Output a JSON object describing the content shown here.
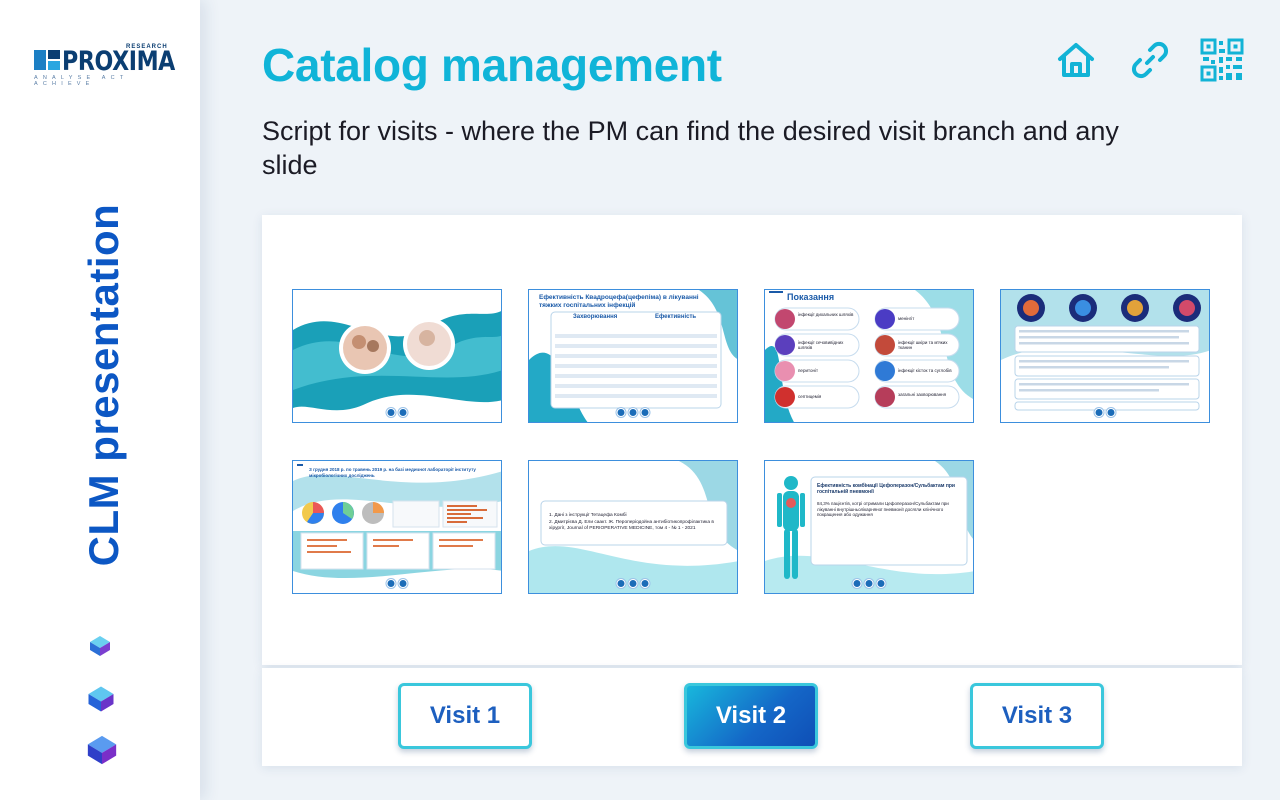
{
  "brand": {
    "name": "PROXIMA",
    "research": "RESEARCH",
    "tagline": "ANALYSE ACT ACHIEVE",
    "colors": {
      "primary": "#0c57c4",
      "accent": "#10b4d8",
      "dark": "#0b3e72"
    }
  },
  "sidebar": {
    "vertical_title": "CLM presentation"
  },
  "header": {
    "title": "Catalog management",
    "subtitle": "Script for visits - where the PM can find the desired visit branch and any slide",
    "icons": [
      "home-icon",
      "link-icon",
      "qr-code-icon"
    ]
  },
  "slides": [
    {
      "id": "slide-1",
      "heading": ""
    },
    {
      "id": "slide-2",
      "heading": "Ефективність Квадроцефа(цефепіма) в лікуванні тяжких госпітальних інфекцій",
      "col1": "Захворювання",
      "col2": "Ефективність"
    },
    {
      "id": "slide-3",
      "heading": "Показання",
      "items": [
        "інфекції дихальних шляхів",
        "менінгіт",
        "інфекції сечовивідних шляхів",
        "інфекції шкіри та м'яких тканин",
        "перитоніт",
        "інфекції кісток та суглобів",
        "септицемія",
        "загальні захворювання"
      ]
    },
    {
      "id": "slide-4",
      "heading": ""
    },
    {
      "id": "slide-5",
      "heading": "З грудня 2018 р. по травень 2019 р. на базі медичної лабораторії інституту мікробіологічних досліджень"
    },
    {
      "id": "slide-6",
      "heading": "",
      "refs": [
        "1. Дані з інструкції Тетацефа Комбі",
        "2. Дмитрієва Д. Ели саакт. Ж. Пероперіодойна антибіотикопрофілактика в хірургії, Journal of PERIOPERATIVE MEDICINE, том 4 - № 1 - 2021"
      ]
    },
    {
      "id": "slide-7",
      "heading": "Ефективність комбінації Цефоперазон/Сульбактам при госпітальній пневмонії",
      "body": "84,3% пацієнтів, котрі отримали Цефоперазон/Сульбактам при лікуванні внутрішньолікарняної пневмонії досягли клінічного покращення або одужання"
    }
  ],
  "visits": {
    "items": [
      {
        "label": "Visit 1",
        "active": false
      },
      {
        "label": "Visit 2",
        "active": true
      },
      {
        "label": "Visit 3",
        "active": false
      }
    ]
  }
}
